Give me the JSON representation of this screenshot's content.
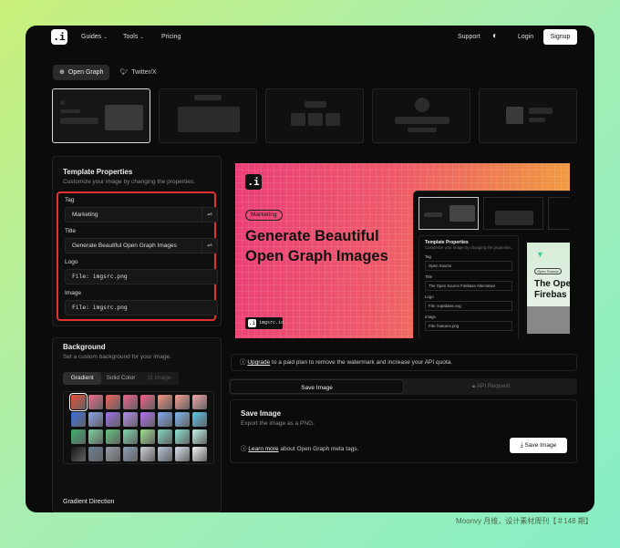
{
  "nav": {
    "guides": "Guides",
    "tools": "Tools",
    "pricing": "Pricing",
    "support": "Support",
    "login": "Login",
    "signup": "Signup",
    "logo": ".i"
  },
  "tabs": [
    "Open Graph",
    "Twitter/X"
  ],
  "template": {
    "title": "Template Properties",
    "subtitle": "Customize your image by changing the properties.",
    "fields": [
      {
        "label": "Tag",
        "value": "Marketing"
      },
      {
        "label": "Title",
        "value": "Generate Beautiful Open Graph Images"
      },
      {
        "label": "Logo",
        "value": "File: imgsrc.png"
      },
      {
        "label": "Image",
        "value": "File: imgsrc.png"
      }
    ]
  },
  "background": {
    "title": "Background",
    "subtitle": "Set a custom background for your image.",
    "modes": [
      "Gradient",
      "Solid Color",
      "Image"
    ],
    "direction_label": "Gradient Direction",
    "directions": [
      "↑",
      "↗",
      "→",
      "↘",
      "↓",
      "↙",
      "←",
      "↖"
    ],
    "swatches": [
      "#e8503a",
      "#ef6b87",
      "#f0605f",
      "#ef5f8a",
      "#f25d84",
      "#f5917a",
      "#f59d92",
      "#f2a3a8",
      "#3b6fe0",
      "#8aa0e8",
      "#9c6ee8",
      "#b48af0",
      "#b26df0",
      "#7ea6f5",
      "#7fb8f0",
      "#59c4e8",
      "#39b06a",
      "#79d29b",
      "#62c47d",
      "#79d6a8",
      "#9ee08c",
      "#7ed8c0",
      "#8ae4d0",
      "#bdf2e5",
      "#151515",
      "#6a7f96",
      "#949ca8",
      "#8a9cb5",
      "#c8ccd2",
      "#b5c4d8",
      "#d8e0ec",
      "#f2f4f7"
    ]
  },
  "preview": {
    "logo": ".i",
    "tag": "Marketing",
    "heading": "Generate Beautiful Open Graph Images",
    "watermark": "imgsrc.io",
    "inner": {
      "title": "Template Properties",
      "subtitle": "Customize your image by changing the properties.",
      "fields": [
        {
          "label": "Tag",
          "value": "Open Source"
        },
        {
          "label": "Title",
          "value": "The Open Source Firebase Alternative"
        },
        {
          "label": "Logo",
          "value": "File: supabase.svg"
        },
        {
          "label": "Image",
          "value": "File: features.png"
        }
      ],
      "card_tag": "Open Source",
      "card_heading": "The Ope Firebas"
    }
  },
  "info": {
    "link": "Upgrade",
    "text": " to a paid plan to remove the watermark and increase your API quota."
  },
  "export_tabs": [
    "Save Image",
    "API Request"
  ],
  "save": {
    "title": "Save Image",
    "subtitle": "Export the image as a PNG.",
    "learn_link": "Learn more",
    "learn_text": " about Open Graph meta tags.",
    "button": "Save Image"
  },
  "caption": "Moonvy 月维，设计素材周刊【＃148 期】"
}
